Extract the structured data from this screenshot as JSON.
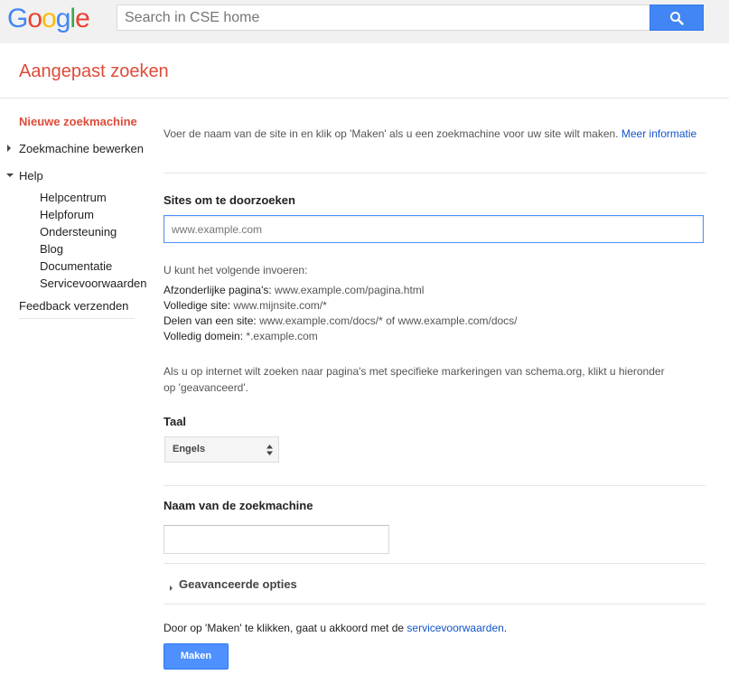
{
  "logo": {
    "letters": [
      "G",
      "o",
      "o",
      "g",
      "l",
      "e"
    ],
    "colors": [
      "#4285f4",
      "#ea4335",
      "#fbbc05",
      "#4285f4",
      "#34a853",
      "#ea4335"
    ]
  },
  "search": {
    "placeholder": "Search in CSE home",
    "icon": "search-icon"
  },
  "app": {
    "title": "Aangepast zoeken"
  },
  "sidebar": {
    "active": "Nieuwe zoekmachine",
    "edit": "Zoekmachine bewerken",
    "help": "Help",
    "help_links": [
      "Helpcentrum",
      "Helpforum",
      "Ondersteuning",
      "Blog",
      "Documentatie",
      "Servicevoorwaarden"
    ],
    "feedback": "Feedback verzenden"
  },
  "main": {
    "intro": "Voer de naam van de site in en klik op 'Maken' als u een zoekmachine voor uw site wilt maken.",
    "more_info_link": "Meer informatie",
    "sites_label": "Sites om te doorzoeken",
    "sites_placeholder": "www.example.com",
    "can_enter": "U kunt het volgende invoeren:",
    "examples": [
      {
        "label": "Afzonderlijke pagina's:",
        "value": "www.example.com/pagina.html"
      },
      {
        "label": "Volledige site:",
        "value": "www.mijnsite.com/*"
      },
      {
        "label": "Delen van een site:",
        "value": "www.example.com/docs/* of www.example.com/docs/"
      },
      {
        "label": "Volledig domein:",
        "value": "*.example.com"
      }
    ],
    "schema_note": "Als u op internet wilt zoeken naar pagina's met specifieke markeringen van schema.org, klikt u hieronder op 'geavanceerd'.",
    "language_label": "Taal",
    "language_value": "Engels",
    "engine_name_label": "Naam van de zoekmachine",
    "engine_name_value": "",
    "advanced_label": "Geavanceerde opties",
    "consent_prefix": "Door op 'Maken' te klikken, gaat u akkoord met de",
    "consent_link": "servicevoorwaarden",
    "consent_suffix": ".",
    "make_button": "Maken"
  },
  "colors": {
    "accent_red": "#dd4b39",
    "primary_blue": "#4d90fe",
    "link_blue": "#15c"
  }
}
